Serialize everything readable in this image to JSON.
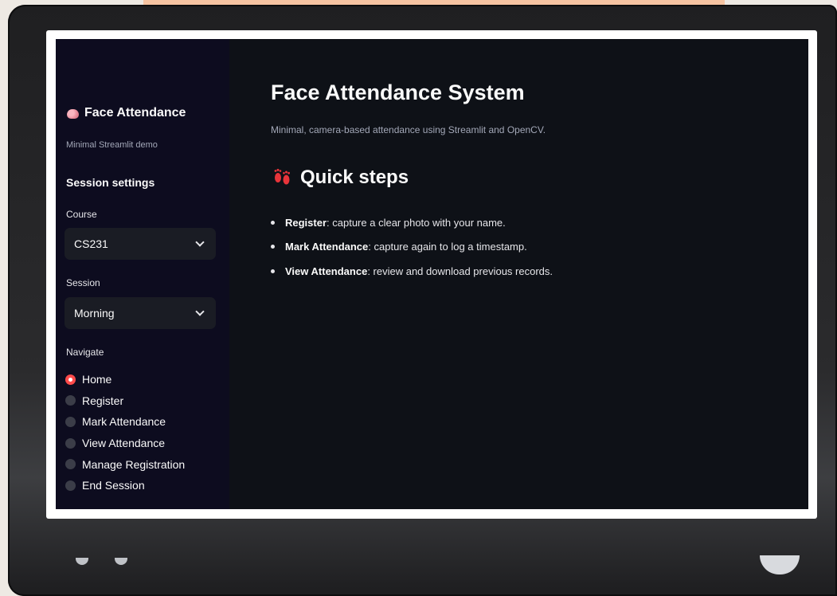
{
  "sidebar": {
    "app_title": "Face Attendance",
    "app_subtitle": "Minimal Streamlit demo",
    "section_title": "Session settings",
    "course_label": "Course",
    "course_value": "CS231",
    "session_label": "Session",
    "session_value": "Morning",
    "navigate_label": "Navigate",
    "nav_items": [
      {
        "label": "Home",
        "selected": true
      },
      {
        "label": "Register",
        "selected": false
      },
      {
        "label": "Mark Attendance",
        "selected": false
      },
      {
        "label": "View Attendance",
        "selected": false
      },
      {
        "label": "Manage Registration",
        "selected": false
      },
      {
        "label": "End Session",
        "selected": false
      }
    ]
  },
  "main": {
    "title": "Face Attendance System",
    "subtitle": "Minimal, camera-based attendance using Streamlit and OpenCV.",
    "steps_title": "Quick steps",
    "steps": [
      {
        "bold": "Register",
        "text": ": capture a clear photo with your name."
      },
      {
        "bold": "Mark Attendance",
        "text": ": capture again to log a timestamp."
      },
      {
        "bold": "View Attendance",
        "text": ": review and download previous records."
      }
    ]
  },
  "icons": {
    "brand": "brain-icon",
    "steps": "footprints-icon",
    "dropdown": "chevron-down-icon"
  },
  "colors": {
    "accent": "#ff4b4b",
    "app_background": "#0e1117",
    "sidebar_background": "#0d0c1f"
  }
}
